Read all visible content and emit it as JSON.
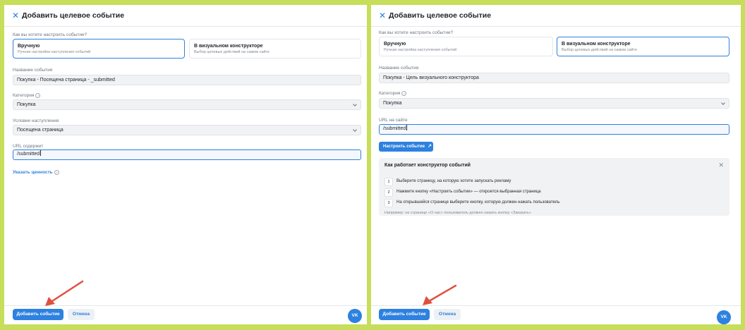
{
  "left_panel": {
    "title": "Добавить целевое событие",
    "setup_question": "Как вы хотите настроить событие?",
    "options": [
      {
        "title": "Вручную",
        "subtitle": "Ручная настройка наступления событий"
      },
      {
        "title": "В визуальном конструкторе",
        "subtitle": "Выбор целевых действий на самом сайте"
      }
    ],
    "selected_option": 0,
    "event_name_label": "Название события",
    "event_name_value": "Покупка - Посещена страница - _submitted",
    "category_label": "Категория",
    "category_value": "Покупка",
    "condition_label": "Условие наступления",
    "condition_value": "Посещена страница",
    "url_label": "URL содержит",
    "url_value": "/submitted",
    "value_link": "Указать ценность",
    "add_button": "Добавить событие",
    "cancel_button": "Отмена",
    "vk_label": "VK"
  },
  "right_panel": {
    "title": "Добавить целевое событие",
    "setup_question": "Как вы хотите настроить событие?",
    "options": [
      {
        "title": "Вручную",
        "subtitle": "Ручная настройка наступления событий"
      },
      {
        "title": "В визуальном конструкторе",
        "subtitle": "Выбор целевых действий на самом сайте"
      }
    ],
    "selected_option": 1,
    "event_name_label": "Название события",
    "event_name_value": "Покупка - Цель визуального конструктора",
    "category_label": "Категория",
    "category_value": "Покупка",
    "url_label": "URL на сайте",
    "url_value": "/submitted",
    "setup_button": "Настроить событие",
    "howto": {
      "title": "Как работает конструктор событий",
      "steps": [
        {
          "num": "1",
          "text": "Выберите страницу, на которую хотите запускать рекламу"
        },
        {
          "num": "2",
          "text": "Нажмите кнопку «Настроить событие» — откроется выбранная страница"
        },
        {
          "num": "3",
          "text": "На открывшейся странице выберите кнопку, которую должен нажать пользователь"
        }
      ],
      "example": "Например: на странице «О нас» пользователь должен нажать кнопку «Заказать»"
    },
    "add_button": "Добавить событие",
    "cancel_button": "Отмена",
    "vk_label": "VK"
  },
  "colors": {
    "background": "#c6de5a",
    "accent": "#2d81e0",
    "annotation_arrow": "#e0503f"
  }
}
